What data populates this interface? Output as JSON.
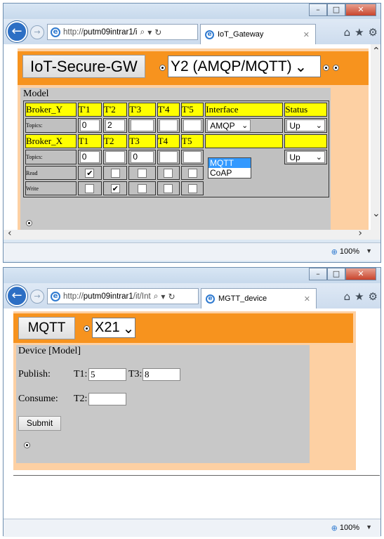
{
  "window1": {
    "url": "http://",
    "url_host": "putm09intrar1/i",
    "tab_title": "IoT_Gateway",
    "gateway_button": "IoT-Secure-GW",
    "gateway_select": "Y2 (AMQP/MQTT)",
    "model_title": "Model",
    "table": {
      "broker_y": {
        "name": "Broker_Y",
        "topic_headers": [
          "T'1",
          "T'2",
          "T'3",
          "T'4",
          "T'5"
        ],
        "interface_header": "Interface",
        "status_header": "Status",
        "topics_label": "Topics:",
        "topics": [
          "0",
          "2",
          "",
          "",
          ""
        ],
        "interface_value": "AMQP",
        "status_value": "Up"
      },
      "broker_x": {
        "name": "Broker_X",
        "topic_headers": [
          "T1",
          "T2",
          "T3",
          "T4",
          "T5"
        ],
        "topics_label": "Topics:",
        "topics": [
          "0",
          "",
          "0",
          "",
          ""
        ],
        "status_value": "Up",
        "interface_options": [
          "MQTT",
          "CoAP"
        ],
        "interface_highlighted": "MQTT"
      },
      "read_label": "Read",
      "write_label": "Write",
      "read_checks": [
        true,
        false,
        false,
        false,
        false
      ],
      "write_checks": [
        false,
        true,
        false,
        false,
        false
      ]
    },
    "zoom": "100%"
  },
  "window2": {
    "url": "http://",
    "url_host": "putm09intrar1",
    "url_path": "/it/Int",
    "tab_title": "MGTT_device",
    "mqtt_button": "MQTT",
    "device_select": "X21",
    "device_title": "Device [Model]",
    "publish_label": "Publish:",
    "t1_label": "T1:",
    "t1_value": "5",
    "t3_label": "T3:",
    "t3_value": "8",
    "consume_label": "Consume:",
    "t2_label": "T2:",
    "t2_value": "",
    "submit_label": "Submit",
    "zoom": "100%"
  },
  "colors": {
    "orange": "#f7931e",
    "peach": "#fdd0a3",
    "yellow": "#ffff00",
    "panel_gray": "#c8c8c8",
    "highlight_blue": "#3399ff"
  },
  "icons": [
    "back-arrow-icon",
    "forward-arrow-icon",
    "ie-icon",
    "search-icon",
    "refresh-icon",
    "home-icon",
    "star-icon",
    "gear-icon",
    "minimize-icon",
    "maximize-icon",
    "close-icon",
    "zoom-icon"
  ]
}
